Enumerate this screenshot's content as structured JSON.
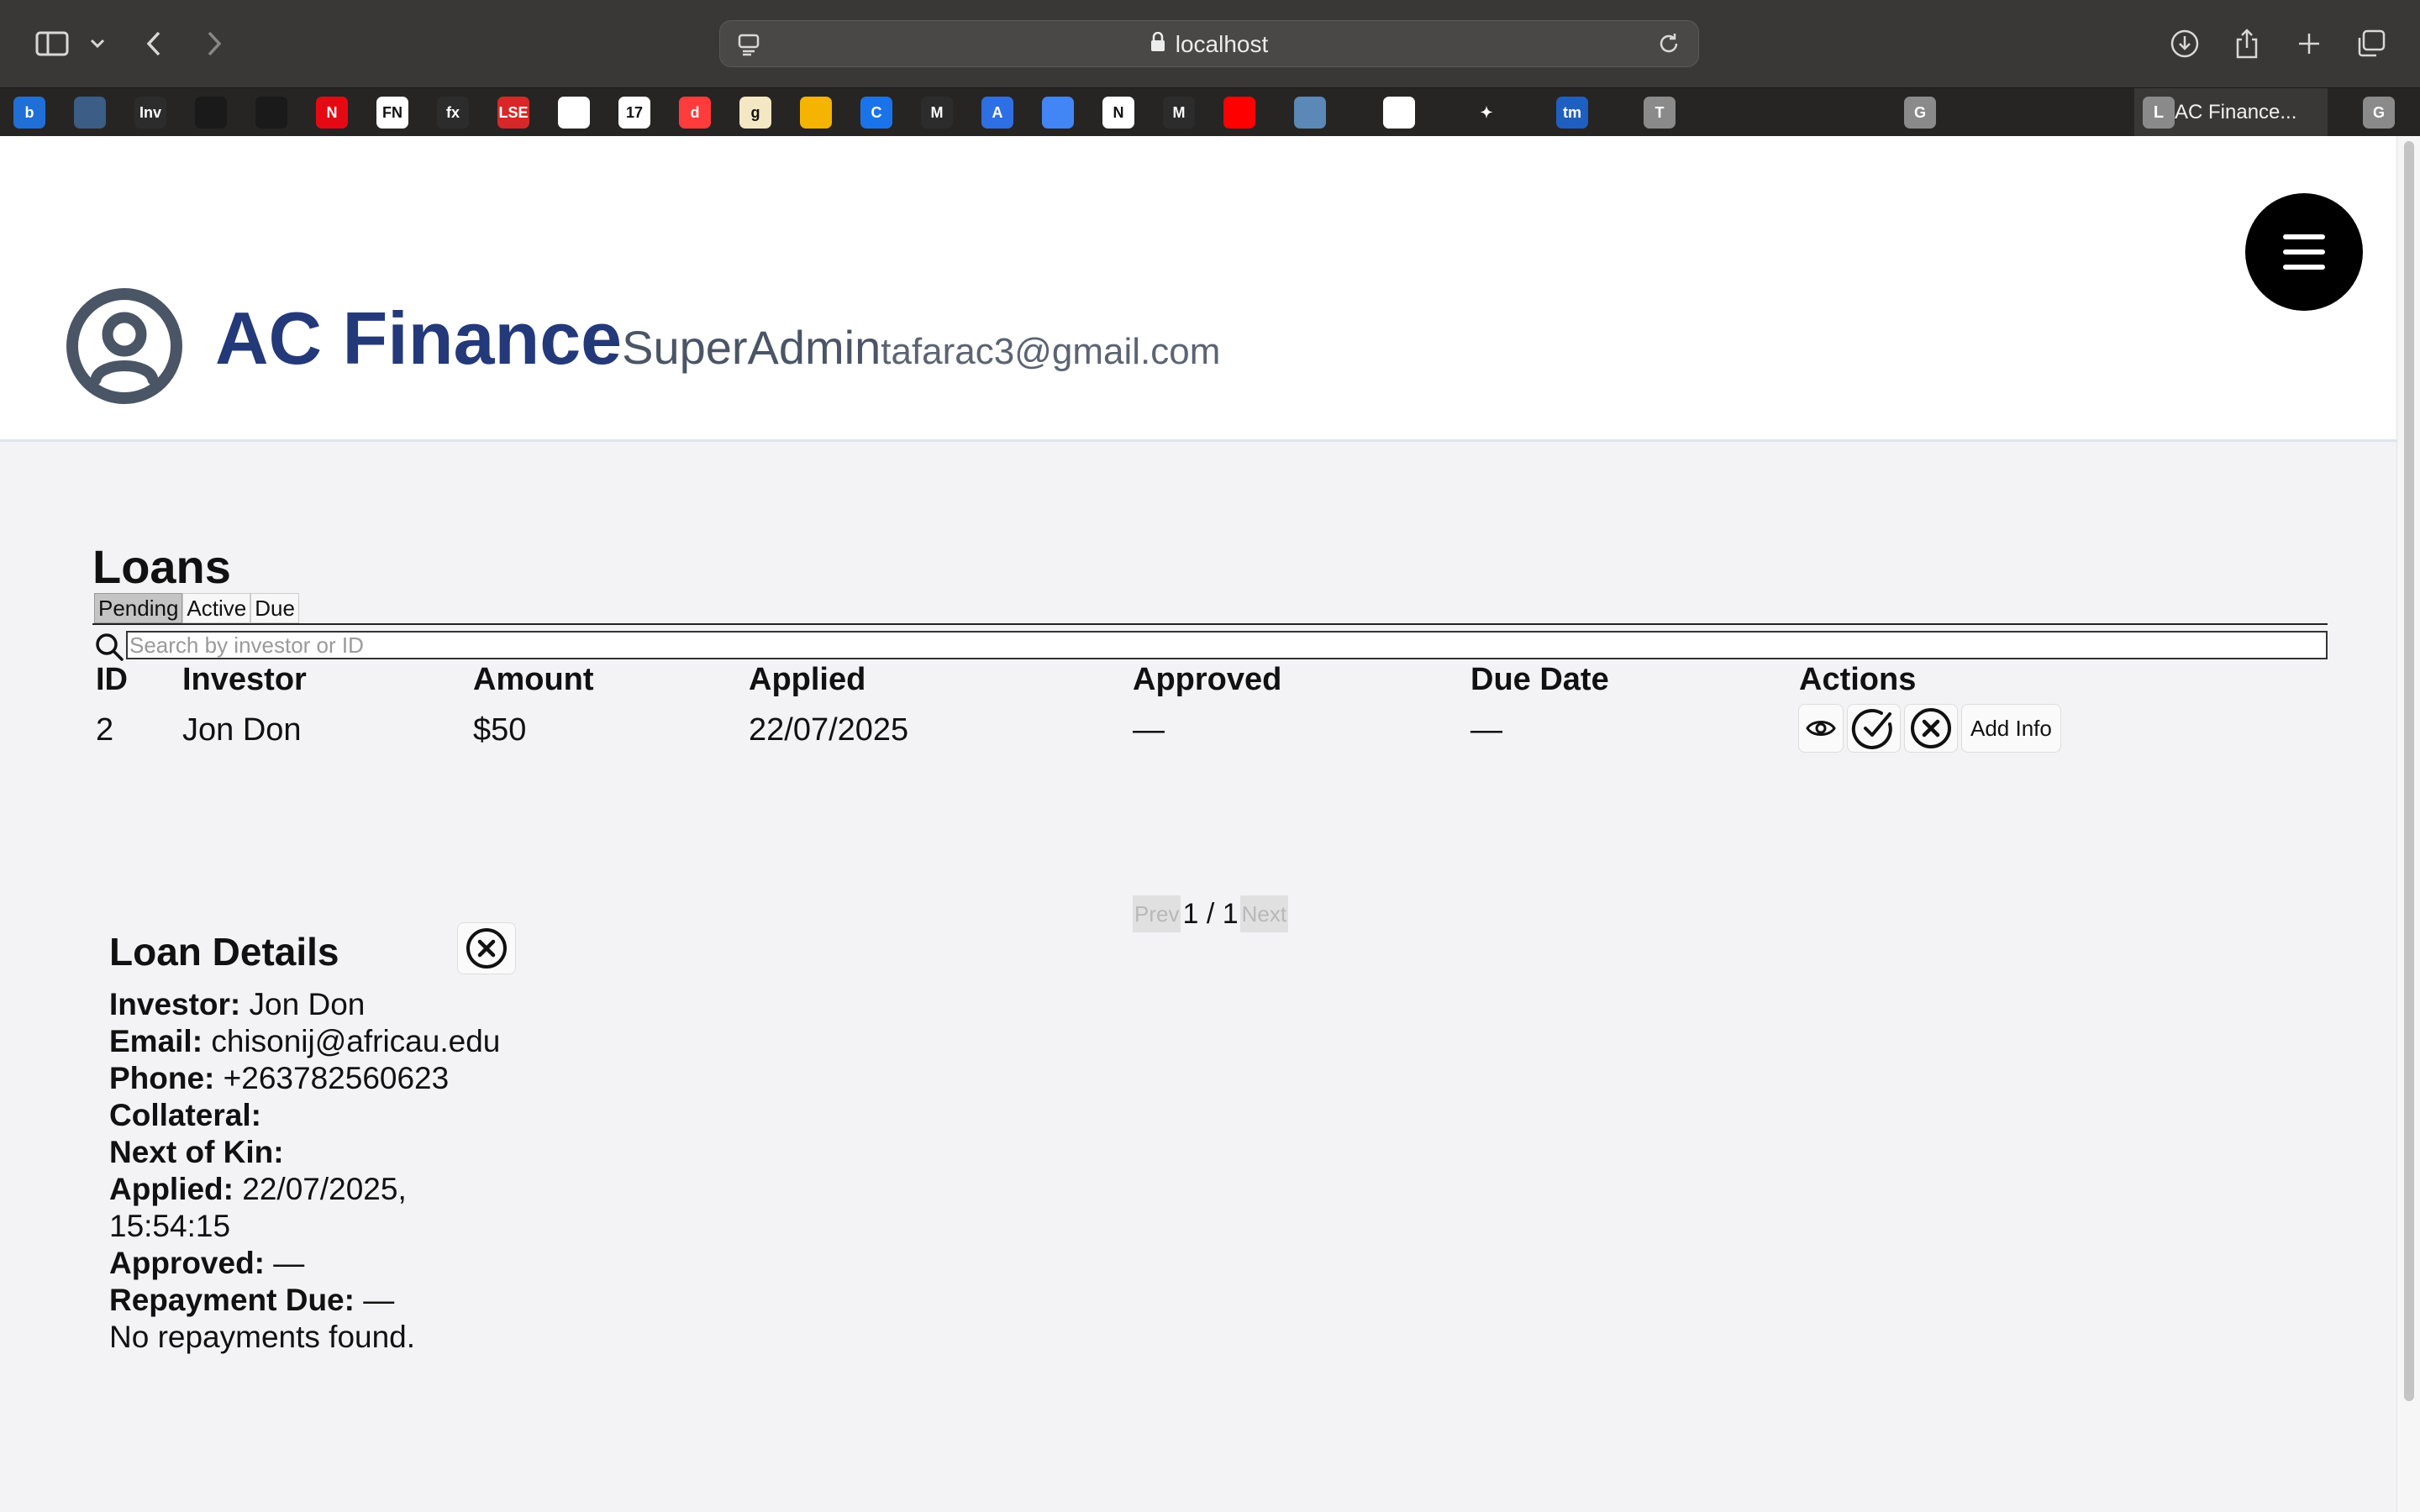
{
  "browser": {
    "url": "localhost",
    "active_tab_title": "AC Finance...",
    "active_tab_letter": "L",
    "favicons": [
      {
        "name": "b-favicon",
        "glyph": "b",
        "bg": "#1f6fd6"
      },
      {
        "name": "globe-favicon",
        "glyph": "",
        "bg": "#3b5d86"
      },
      {
        "name": "inv-favicon",
        "glyph": "Inv",
        "bg": "#2c2c2c"
      },
      {
        "name": "robot-favicon",
        "glyph": "",
        "bg": "#1a1a1a"
      },
      {
        "name": "diamond-favicon",
        "glyph": "",
        "bg": "#1a1a1a"
      },
      {
        "name": "netflix-favicon",
        "glyph": "N",
        "bg": "#e50914"
      },
      {
        "name": "fn-favicon",
        "glyph": "FN",
        "bg": "#ffffff"
      },
      {
        "name": "fx-favicon",
        "glyph": "fx",
        "bg": "#2c2c2c"
      },
      {
        "name": "lse-favicon",
        "glyph": "LSE",
        "bg": "#d62828"
      },
      {
        "name": "bird-favicon",
        "glyph": "",
        "bg": "#ffffff"
      },
      {
        "name": "tv-favicon",
        "glyph": "17",
        "bg": "#ffffff"
      },
      {
        "name": "d-favicon",
        "glyph": "d",
        "bg": "#ff3b3b"
      },
      {
        "name": "g-favicon",
        "glyph": "g",
        "bg": "#f3e7c4"
      },
      {
        "name": "slides-favicon",
        "glyph": "",
        "bg": "#f4b400"
      },
      {
        "name": "c-favicon",
        "glyph": "C",
        "bg": "#1a73e8"
      },
      {
        "name": "gmail-favicon",
        "glyph": "M",
        "bg": "#2c2c2c"
      },
      {
        "name": "a-favicon",
        "glyph": "A",
        "bg": "#2f6fe4"
      },
      {
        "name": "docs-favicon",
        "glyph": "",
        "bg": "#4285f4"
      },
      {
        "name": "notion-favicon",
        "glyph": "N",
        "bg": "#ffffff"
      },
      {
        "name": "m-favicon",
        "glyph": "M",
        "bg": "#2c2c2c"
      },
      {
        "name": "youtube-favicon",
        "glyph": "",
        "bg": "#ff0000"
      },
      {
        "name": "earth-favicon",
        "glyph": "",
        "bg": "#5b88b6"
      },
      {
        "name": "openai-favicon",
        "glyph": "",
        "bg": "#ffffff"
      },
      {
        "name": "sparkle-favicon",
        "glyph": "✦",
        "bg": "#262524"
      },
      {
        "name": "tm-favicon",
        "glyph": "tm",
        "bg": "#1f5fbf"
      },
      {
        "name": "t-favicon",
        "glyph": "T",
        "bg": "#8a8a8a"
      },
      {
        "name": "frog-favicon",
        "glyph": "",
        "bg": "#262524"
      },
      {
        "name": "frog2-favicon",
        "glyph": "",
        "bg": "#262524"
      },
      {
        "name": "g-grey-favicon",
        "glyph": "G",
        "bg": "#8a8a8a"
      },
      {
        "name": "compass-favicon",
        "glyph": "",
        "bg": "#262524"
      },
      {
        "name": "tailwind-favicon",
        "glyph": "",
        "bg": "#262524"
      }
    ],
    "trailing_tab_letter": "G"
  },
  "header": {
    "brand": "AC Finance",
    "role": "SuperAdmin",
    "email": "tafarac3@gmail.com"
  },
  "loans": {
    "title": "Loans",
    "tabs": [
      "Pending",
      "Active",
      "Due"
    ],
    "selected_tab": "Pending",
    "search_placeholder": "Search by investor or ID",
    "columns": [
      "ID",
      "Investor",
      "Amount",
      "Applied",
      "Approved",
      "Due Date",
      "Actions"
    ],
    "rows": [
      {
        "id": "2",
        "investor": "Jon Don",
        "amount": "$50",
        "applied": "22/07/2025",
        "approved": "—",
        "due_date": "—"
      }
    ],
    "actions": {
      "add_info": "Add Info"
    },
    "pager": {
      "prev": "Prev",
      "page": "1 / 1",
      "next": "Next"
    }
  },
  "details": {
    "title": "Loan Details",
    "investor_label": "Investor:",
    "investor": "Jon Don",
    "email_label": "Email:",
    "email": "chisonij@africau.edu",
    "phone_label": "Phone:",
    "phone": "+263782560623",
    "collateral_label": "Collateral:",
    "kin_label": "Next of Kin:",
    "applied_label": "Applied:",
    "applied_date": "22/07/2025,",
    "applied_time": "15:54:15",
    "approved_label": "Approved:",
    "approved": "—",
    "repayment_label": "Repayment Due:",
    "repayment": "—",
    "no_repayments": "No repayments found."
  }
}
